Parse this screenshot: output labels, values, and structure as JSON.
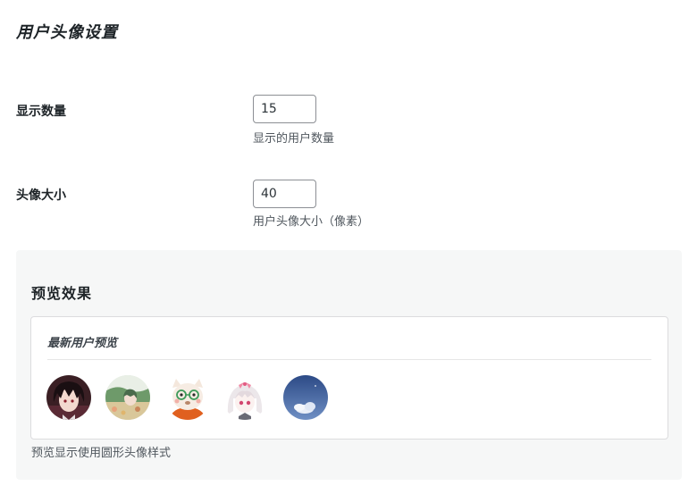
{
  "page": {
    "title": "用户头像设置"
  },
  "settings": {
    "count": {
      "label": "显示数量",
      "value": "15",
      "description": "显示的用户数量"
    },
    "size": {
      "label": "头像大小",
      "value": "40",
      "description": "用户头像大小（像素）"
    }
  },
  "preview": {
    "title": "预览效果",
    "card_title": "最新用户预览",
    "avatars": [
      {
        "name": "dark-haired-anime-boy",
        "icon": "user-avatar-icon"
      },
      {
        "name": "green-landscape-girl",
        "icon": "user-avatar-icon"
      },
      {
        "name": "cream-cat-with-glasses",
        "icon": "user-avatar-icon"
      },
      {
        "name": "pink-haired-girl",
        "icon": "user-avatar-icon"
      },
      {
        "name": "blue-sky-clouds",
        "icon": "user-avatar-icon"
      }
    ],
    "note": "预览显示使用圆形头像样式"
  }
}
